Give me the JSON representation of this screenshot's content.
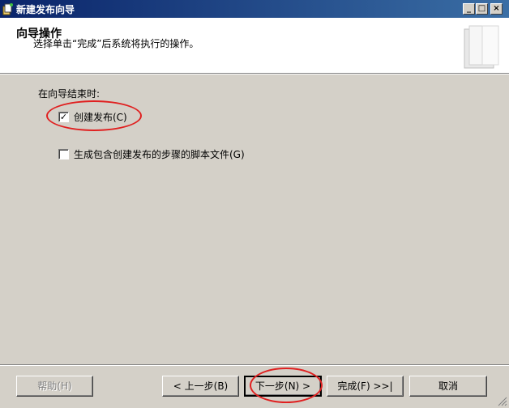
{
  "window": {
    "title": "新建发布向导",
    "controls": [
      "minimize-icon",
      "maximize-icon",
      "close-icon"
    ],
    "control_glyphs": {
      "minimize": "_",
      "maximize": "□",
      "close": "×"
    }
  },
  "header": {
    "title": "向导操作",
    "subtitle": "选择单击“完成”后系统将执行的操作。"
  },
  "body": {
    "group_label": "在向导结束时:",
    "options": [
      {
        "label": "创建发布(C)",
        "checked": true
      },
      {
        "label": "生成包含创建发布的步骤的脚本文件(G)",
        "checked": false
      }
    ]
  },
  "footer": {
    "help": "帮助(H)",
    "back": "< 上一步(B)",
    "next": "下一步(N) >",
    "finish": "完成(F) >>|",
    "cancel": "取消"
  },
  "colors": {
    "titlebar_start": "#0a246a",
    "titlebar_end": "#3a6ea5",
    "annotation": "#e02020",
    "dialog_bg": "#d4d0c8"
  }
}
